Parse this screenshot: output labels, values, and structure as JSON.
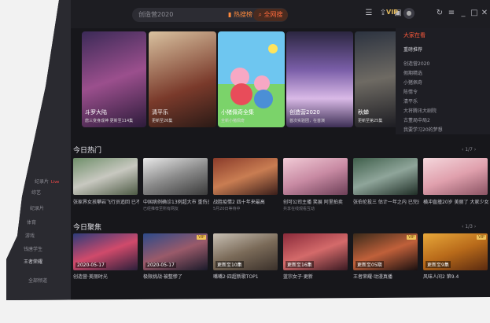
{
  "search": {
    "placeholder": "创造营2020",
    "hot_label": "热搜榜",
    "button_label": "全网搜"
  },
  "vip_label": "VIP",
  "sidebar": {
    "items": [
      {
        "label": "纪录片",
        "active": false
      },
      {
        "label": "综艺"
      },
      {
        "label": "纪录片"
      },
      {
        "label": "体育"
      },
      {
        "label": "游戏"
      },
      {
        "label": "钱唐学生"
      },
      {
        "label": "王者荣耀"
      },
      {
        "label": "全部频道"
      }
    ],
    "live_badge": "Live"
  },
  "hero": [
    {
      "title": "斗罗大陆",
      "subtitle": "唐三变身成神 更新至114集"
    },
    {
      "title": "清平乐",
      "subtitle": "更新至26集"
    },
    {
      "title": "小猪佩奇全集",
      "subtitle": "全新小猪佩奇"
    },
    {
      "title": "创造营2020",
      "subtitle": "首次实验团，在首演"
    },
    {
      "title": "秋蝉",
      "subtitle": "更新至第25集"
    }
  ],
  "side_panel": {
    "title": "大家在看",
    "items": [
      "重磅推荐",
      "创造营2020",
      "假期精选",
      "小猪佩奇",
      "陈情令",
      "清平乐",
      "大将腾讯大剧院",
      "古董局中局2",
      "我要学习20的梦想"
    ]
  },
  "today_hot": {
    "title": "今日热门",
    "pager": "1/7",
    "items": [
      {
        "title": "张家界女孩攀岩飞行员追回 已不幸身亡",
        "sub": ""
      },
      {
        "title": "中国病例确诊13例超大市 重伤员者不治",
        "sub": "已经推荐至所有网友"
      },
      {
        "title": "战胜疫情2 四十年来最高",
        "sub": "5月20日等待中"
      },
      {
        "title": "创可公司主播 笑展 阿里拍卖",
        "sub": "共享在线观看互动"
      },
      {
        "title": "张伯伦投三 估计一年之内 已完成结婚",
        "sub": ""
      },
      {
        "title": "横冲直撞20岁 美丽了 大家少女华丽回归",
        "sub": ""
      }
    ]
  },
  "today_focus": {
    "title": "今日聚焦",
    "pager": "1/3",
    "items": [
      {
        "title": "创造营·美丽时光",
        "date": "2020-05-17",
        "vip": false
      },
      {
        "title": "极限挑战·被整惨了",
        "date": "2020-05-17",
        "vip": true
      },
      {
        "title": "嘴嘴2·四超新歌TOP1",
        "date": "更新至10集",
        "vip": false
      },
      {
        "title": "蓝宗女子·更新",
        "date": "更新至16集",
        "vip": false
      },
      {
        "title": "王者荣耀·动漫真播",
        "date": "更新至05期",
        "vip": true
      },
      {
        "title": "风味人间2 第9.4",
        "date": "更新至9集",
        "vip": true
      }
    ]
  },
  "colors": {
    "accent": "#ff5a3c",
    "bg": "#17171b",
    "vip": "#f0c35b"
  }
}
